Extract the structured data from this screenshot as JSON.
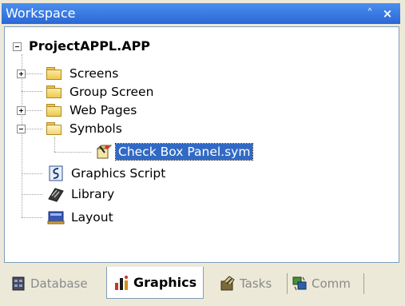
{
  "window": {
    "title": "Workspace",
    "pin_glyph": "˄",
    "close_glyph": "×"
  },
  "tree": {
    "root": {
      "label": "ProjectAPPL.APP",
      "expanded": true
    },
    "items": [
      {
        "label": "Screens",
        "icon": "folder-icon",
        "expander": "plus"
      },
      {
        "label": "Group Screen",
        "icon": "folder-icon",
        "expander": "none"
      },
      {
        "label": "Web Pages",
        "icon": "folder-icon",
        "expander": "plus"
      },
      {
        "label": "Symbols",
        "icon": "open-folder-icon",
        "expander": "minus",
        "children": [
          {
            "label": "Check Box Panel.sym",
            "icon": "symbol-file-icon",
            "selected": true
          }
        ]
      },
      {
        "label": "Graphics Script",
        "icon": "script-icon",
        "expander": "none"
      },
      {
        "label": "Library",
        "icon": "library-icon",
        "expander": "none"
      },
      {
        "label": "Layout",
        "icon": "layout-icon",
        "expander": "none"
      }
    ]
  },
  "tabs": [
    {
      "label": "Database",
      "icon": "database-icon",
      "active": false
    },
    {
      "label": "Graphics",
      "icon": "graphics-icon",
      "active": true
    },
    {
      "label": "Tasks",
      "icon": "tasks-icon",
      "active": false
    },
    {
      "label": "Comm",
      "icon": "comm-icon",
      "active": false
    }
  ],
  "colors": {
    "title_bar": "#2a67d6",
    "selection": "#316ac5",
    "panel_bg": "#ece9d8"
  }
}
